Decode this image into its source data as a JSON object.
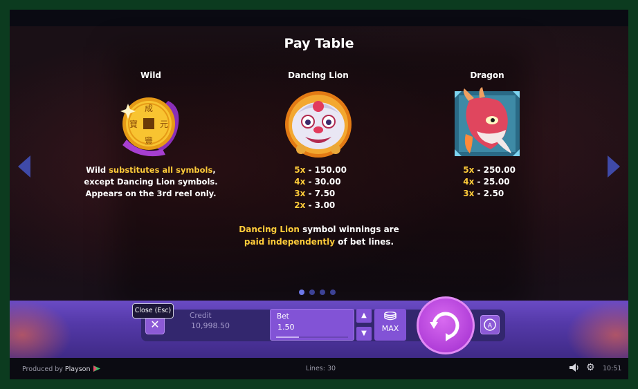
{
  "title": "Pay Table",
  "symbols": {
    "wild": {
      "name": "Wild",
      "icon": "golden-coin-icon",
      "desc_line1_prefix": "Wild ",
      "desc_line1_highlight": "substitutes all symbols",
      "desc_line1_suffix": ",",
      "desc_line2": "except Dancing Lion symbols.",
      "desc_line3": "Appears on the 3rd reel only."
    },
    "lion": {
      "name": "Dancing Lion",
      "icon": "dancing-lion-icon",
      "pays": [
        {
          "mult": "5x",
          "value": "150.00"
        },
        {
          "mult": "4x",
          "value": "30.00"
        },
        {
          "mult": "3x",
          "value": "7.50"
        },
        {
          "mult": "2x",
          "value": "3.00"
        }
      ]
    },
    "dragon": {
      "name": "Dragon",
      "icon": "dragon-icon",
      "pays": [
        {
          "mult": "5x",
          "value": "250.00"
        },
        {
          "mult": "4x",
          "value": "25.00"
        },
        {
          "mult": "3x",
          "value": "2.50"
        }
      ]
    }
  },
  "note": {
    "hl1": "Dancing Lion",
    "text1": " symbol winnings are",
    "hl2": "paid independently",
    "text2": " of bet lines."
  },
  "pagination": {
    "pages": 4,
    "active": 1
  },
  "controls": {
    "close_tooltip": "Close (Esc)",
    "close_glyph": "✕",
    "credit_label": "Credit",
    "credit_value": "10,998.50",
    "bet_label": "Bet",
    "bet_value": "1.50",
    "bet_level": 0.32,
    "bet_up": "▲",
    "bet_down": "▼",
    "max_label": "MAX"
  },
  "footer": {
    "produced_by": "Produced by ",
    "brand": "Playson",
    "lines": "Lines: 30",
    "time": "10:51"
  },
  "colors": {
    "highlight": "#ffcc3a",
    "accent_purple": "#8253d6",
    "spin_purple": "#b03ed8"
  }
}
